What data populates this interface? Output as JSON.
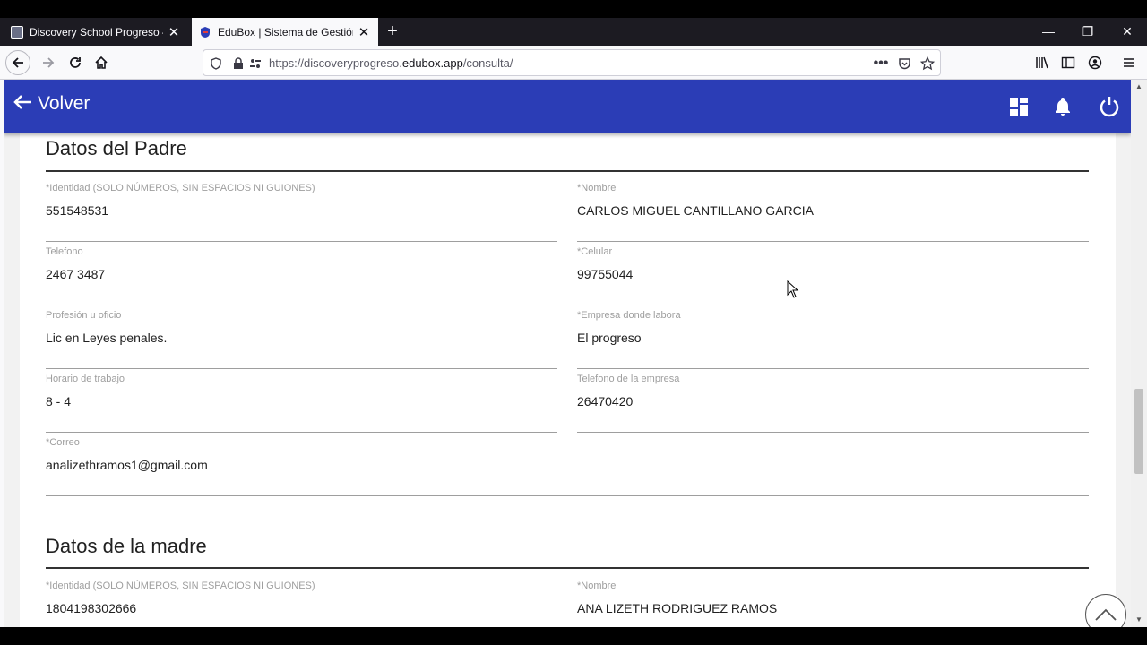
{
  "browser": {
    "tabs": [
      {
        "title": "Discovery School Progreso – | (",
        "active": false
      },
      {
        "title": "EduBox | Sistema de Gestión Es",
        "active": true
      }
    ],
    "url_prefix": "https://discoveryprogreso.",
    "url_host": "edubox.app",
    "url_path": "/consulta/"
  },
  "appbar": {
    "back_label": "Volver",
    "color": "#2b3db6"
  },
  "padre": {
    "title": "Datos del Padre",
    "fields": [
      {
        "label": "*Identidad (SOLO NÚMEROS, SIN ESPACIOS NI GUIONES)",
        "value": "551548531"
      },
      {
        "label": "*Nombre",
        "value": "CARLOS MIGUEL CANTILLANO GARCIA"
      },
      {
        "label": "Telefono",
        "value": "2467 3487"
      },
      {
        "label": "*Celular",
        "value": "99755044"
      },
      {
        "label": "Profesión u oficio",
        "value": "Lic en Leyes penales."
      },
      {
        "label": "*Empresa donde labora",
        "value": "El progreso"
      },
      {
        "label": "Horario de trabajo",
        "value": "8 - 4"
      },
      {
        "label": "Telefono de la empresa",
        "value": "26470420"
      },
      {
        "label": "*Correo",
        "value": "analizethramos1@gmail.com"
      }
    ]
  },
  "madre": {
    "title": "Datos de la madre",
    "fields": [
      {
        "label": "*Identidad (SOLO NÚMEROS, SIN ESPACIOS NI GUIONES)",
        "value": "1804198302666"
      },
      {
        "label": "*Nombre",
        "value": "ANA LIZETH RODRIGUEZ RAMOS"
      }
    ]
  },
  "icons": {
    "dashboard": "dashboard-icon",
    "notifications": "bell-icon",
    "power": "power-icon",
    "scroll_top": "chevron-up-icon"
  }
}
